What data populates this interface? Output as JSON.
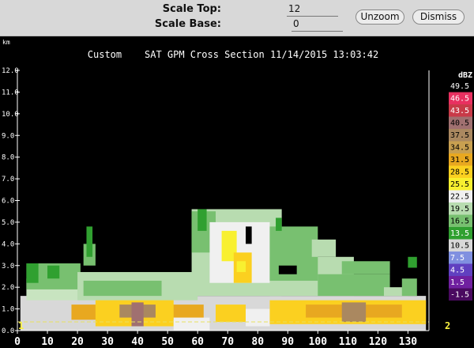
{
  "toolbar": {
    "scale_top_label": "Scale Top:",
    "scale_top_value": "12",
    "scale_base_label": "Scale Base:",
    "scale_base_value": "0",
    "unzoom_label": "Unzoom",
    "dismiss_label": "Dismiss"
  },
  "chart_data": {
    "type": "heatmap",
    "title": "Custom    SAT GPM Cross Section 11/14/2015 13:03:42",
    "y_unit_label": "km",
    "xlim": [
      0,
      137
    ],
    "ylim": [
      0,
      12
    ],
    "x_ticks": [
      0,
      10,
      20,
      30,
      40,
      50,
      60,
      70,
      80,
      90,
      100,
      110,
      120,
      130
    ],
    "y_ticks": [
      "0.0",
      "1.0",
      "2.0",
      "3.0",
      "4.0",
      "5.0",
      "6.0",
      "7.0",
      "8.0",
      "9.0",
      "10.0",
      "11.0",
      "12.0"
    ],
    "endpoint_labels": [
      "1",
      "2"
    ],
    "colorbar": {
      "unit": "dBZ",
      "levels": [
        {
          "label": "49.5",
          "color": "#000000"
        },
        {
          "label": "46.5",
          "color": "#e83060"
        },
        {
          "label": "43.5",
          "color": "#c83a48"
        },
        {
          "label": "40.5",
          "color": "#a07070"
        },
        {
          "label": "37.5",
          "color": "#aa8860"
        },
        {
          "label": "34.5",
          "color": "#c8a050"
        },
        {
          "label": "31.5",
          "color": "#e8a820"
        },
        {
          "label": "28.5",
          "color": "#fbd020"
        },
        {
          "label": "25.5",
          "color": "#f8f030"
        },
        {
          "label": "22.5",
          "color": "#f0f0f0"
        },
        {
          "label": "19.5",
          "color": "#b8dcb0"
        },
        {
          "label": "16.5",
          "color": "#78c070"
        },
        {
          "label": "13.5",
          "color": "#30a030"
        },
        {
          "label": "10.5",
          "color": "#d8d8d8"
        },
        {
          "label": "7.5",
          "color": "#8090e0"
        },
        {
          "label": "4.5",
          "color": "#6040c0"
        },
        {
          "label": "1.5",
          "color": "#7020a0"
        },
        {
          "label": "-1.5",
          "color": "#4a0a60"
        }
      ]
    },
    "regions": [
      {
        "x": [
          1,
          136
        ],
        "y": [
          0,
          1.6
        ],
        "color": "#d8d8d8"
      },
      {
        "x": [
          3,
          23
        ],
        "y": [
          1.4,
          2.4
        ],
        "color": "#c8e4c0"
      },
      {
        "x": [
          3,
          21
        ],
        "y": [
          1.9,
          3.1
        ],
        "color": "#78c070"
      },
      {
        "x": [
          3,
          7
        ],
        "y": [
          2.2,
          3.1
        ],
        "color": "#30a030"
      },
      {
        "x": [
          10,
          14
        ],
        "y": [
          2.4,
          3.0
        ],
        "color": "#30a030"
      },
      {
        "x": [
          20,
          60
        ],
        "y": [
          1.4,
          2.7
        ],
        "color": "#b8dcb0"
      },
      {
        "x": [
          22,
          48
        ],
        "y": [
          1.6,
          2.3
        ],
        "color": "#78c070"
      },
      {
        "x": [
          22,
          26
        ],
        "y": [
          3.0,
          4.0
        ],
        "color": "#78c070"
      },
      {
        "x": [
          23,
          25
        ],
        "y": [
          3.4,
          4.8
        ],
        "color": "#30a030"
      },
      {
        "x": [
          58,
          88
        ],
        "y": [
          1.6,
          5.6
        ],
        "color": "#b8dcb0"
      },
      {
        "x": [
          58,
          66
        ],
        "y": [
          3.6,
          5.5
        ],
        "color": "#78c070"
      },
      {
        "x": [
          60,
          63
        ],
        "y": [
          4.6,
          5.6
        ],
        "color": "#30a030"
      },
      {
        "x": [
          64,
          84
        ],
        "y": [
          2.2,
          5.0
        ],
        "color": "#f0f0f0"
      },
      {
        "x": [
          68,
          73
        ],
        "y": [
          3.2,
          4.6
        ],
        "color": "#f8f030"
      },
      {
        "x": [
          72,
          78
        ],
        "y": [
          2.2,
          3.6
        ],
        "color": "#fbd020"
      },
      {
        "x": [
          73,
          76
        ],
        "y": [
          2.7,
          3.2
        ],
        "color": "#f8f030"
      },
      {
        "x": [
          76,
          78
        ],
        "y": [
          4.0,
          4.8
        ],
        "color": "#000000"
      },
      {
        "x": [
          84,
          112
        ],
        "y": [
          1.6,
          3.4
        ],
        "color": "#b8dcb0"
      },
      {
        "x": [
          84,
          100
        ],
        "y": [
          2.3,
          4.8
        ],
        "color": "#78c070"
      },
      {
        "x": [
          86,
          88
        ],
        "y": [
          4.6,
          5.2
        ],
        "color": "#30a030"
      },
      {
        "x": [
          87,
          93
        ],
        "y": [
          2.6,
          3.0
        ],
        "color": "#000000"
      },
      {
        "x": [
          98,
          106
        ],
        "y": [
          3.4,
          4.2
        ],
        "color": "#b8dcb0"
      },
      {
        "x": [
          100,
          124
        ],
        "y": [
          1.6,
          2.6
        ],
        "color": "#78c070"
      },
      {
        "x": [
          108,
          124
        ],
        "y": [
          2.6,
          3.2
        ],
        "color": "#78c070"
      },
      {
        "x": [
          122,
          130
        ],
        "y": [
          1.6,
          2.0
        ],
        "color": "#b8dcb0"
      },
      {
        "x": [
          128,
          133
        ],
        "y": [
          1.6,
          2.4
        ],
        "color": "#78c070"
      },
      {
        "x": [
          130,
          133
        ],
        "y": [
          2.9,
          3.4
        ],
        "color": "#30a030"
      },
      {
        "x": [
          18,
          62
        ],
        "y": [
          0.5,
          1.2
        ],
        "color": "#e8a820"
      },
      {
        "x": [
          26,
          52
        ],
        "y": [
          0.2,
          1.4
        ],
        "color": "#fbd020"
      },
      {
        "x": [
          34,
          46
        ],
        "y": [
          0.6,
          1.2
        ],
        "color": "#aa8860"
      },
      {
        "x": [
          38,
          42
        ],
        "y": [
          0.2,
          1.3
        ],
        "color": "#a07070"
      },
      {
        "x": [
          52,
          64
        ],
        "y": [
          0.0,
          0.6
        ],
        "color": "#f0f0f0"
      },
      {
        "x": [
          66,
          76
        ],
        "y": [
          0.4,
          1.2
        ],
        "color": "#fbd020"
      },
      {
        "x": [
          76,
          84
        ],
        "y": [
          0.2,
          1.0
        ],
        "color": "#f0f0f0"
      },
      {
        "x": [
          84,
          136
        ],
        "y": [
          0.3,
          1.4
        ],
        "color": "#fbd020"
      },
      {
        "x": [
          96,
          128
        ],
        "y": [
          0.6,
          1.2
        ],
        "color": "#e8a820"
      },
      {
        "x": [
          108,
          116
        ],
        "y": [
          0.4,
          1.3
        ],
        "color": "#aa8860"
      }
    ]
  }
}
